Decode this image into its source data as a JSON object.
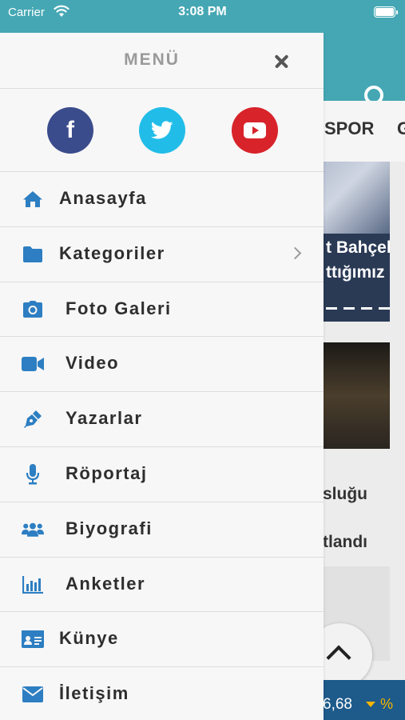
{
  "status_bar": {
    "carrier": "Carrier",
    "time": "3:08 PM"
  },
  "background": {
    "tabs": [
      "SPOR",
      "G"
    ],
    "headline_lines": [
      "t Bahçel",
      "ttığımız"
    ],
    "text_lines": [
      "sluğu",
      "tlandı"
    ],
    "ticker": {
      "value": "6,68",
      "unit": "%"
    }
  },
  "drawer": {
    "title": "MENÜ",
    "social": [
      {
        "name": "facebook",
        "glyph": "f",
        "color": "#3b4c8c"
      },
      {
        "name": "twitter",
        "color": "#21bde8"
      },
      {
        "name": "youtube",
        "color": "#d8232a"
      }
    ],
    "items": [
      {
        "label": "Anasayfa",
        "icon": "home-icon"
      },
      {
        "label": "Kategoriler",
        "icon": "folder-icon",
        "has_submenu": true
      },
      {
        "label": "Foto Galeri",
        "icon": "camera-icon"
      },
      {
        "label": "Video",
        "icon": "video-camera-icon"
      },
      {
        "label": "Yazarlar",
        "icon": "pen-icon"
      },
      {
        "label": "Röportaj",
        "icon": "microphone-icon"
      },
      {
        "label": "Biyografi",
        "icon": "users-icon"
      },
      {
        "label": "Anketler",
        "icon": "poll-chart-icon"
      },
      {
        "label": "Künye",
        "icon": "id-card-icon"
      },
      {
        "label": "İletişim",
        "icon": "envelope-icon"
      }
    ],
    "accent_color": "#2d7ec2"
  }
}
